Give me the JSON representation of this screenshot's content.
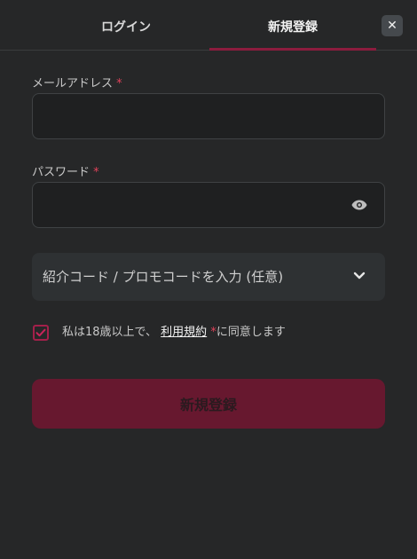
{
  "tabs": [
    {
      "label": "ログイン"
    },
    {
      "label": "新規登録"
    }
  ],
  "close_label": "✕",
  "email": {
    "label": "メールアドレス",
    "required_mark": "*",
    "value": "",
    "placeholder": ""
  },
  "password": {
    "label": "パスワード",
    "required_mark": "*",
    "value": "",
    "placeholder": ""
  },
  "promo": {
    "label": "紹介コード / プロモコードを入力 (任意)"
  },
  "agreement": {
    "checked": true,
    "prefix": "私は18歳以上で、",
    "link": "利用規約",
    "required_mark": "*",
    "suffix": "に同意します"
  },
  "submit_label": "新規登録",
  "colors": {
    "accent": "#8c1c3e",
    "button": "#67182f",
    "background": "#262728"
  }
}
